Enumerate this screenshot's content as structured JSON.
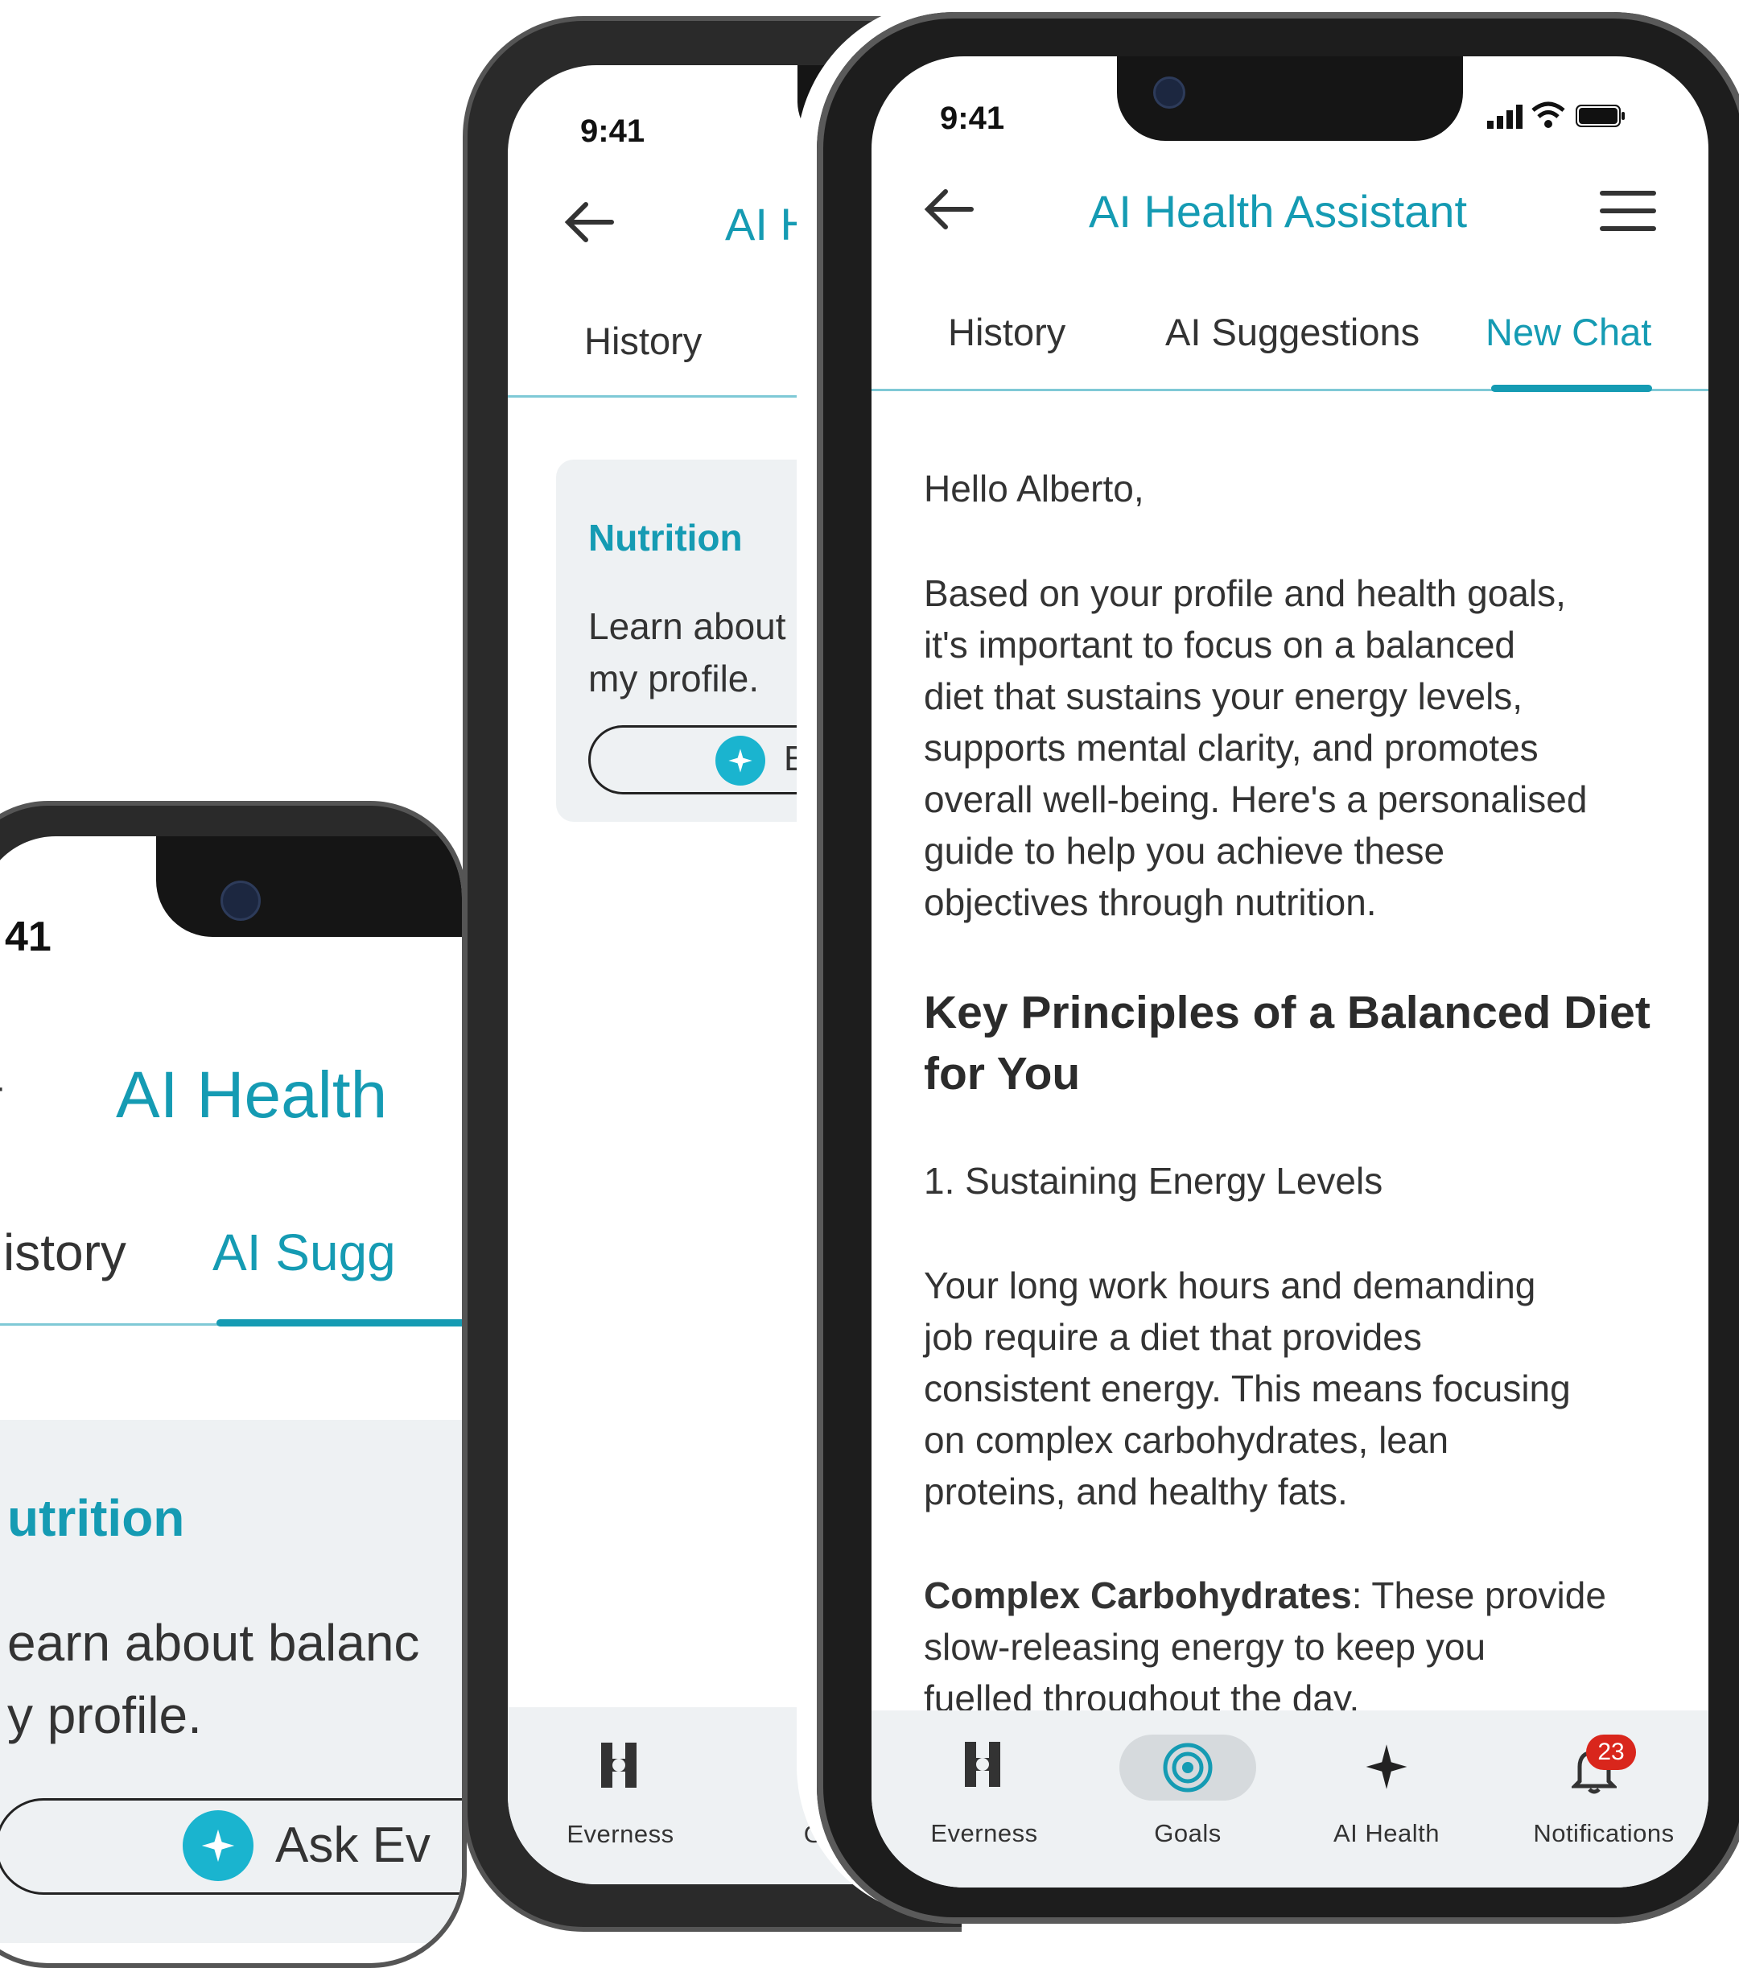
{
  "status": {
    "time": "9:41",
    "time_short": "41"
  },
  "header": {
    "title": "AI Health Assistant",
    "title_partial_small": "AI H",
    "title_partial_large": "AI Health"
  },
  "tabs": {
    "history": "History",
    "ai_suggestions": "AI Suggestions",
    "new_chat": "New Chat",
    "history_partial": "istory",
    "ai_sugg_partial": "AI Sugg",
    "ai_partial": "A"
  },
  "card": {
    "title": "Nutrition",
    "title_partial": "utrition",
    "line1": "Learn about",
    "line2": "my profile.",
    "line1_large": "earn about balanc",
    "line2_large": "y profile.",
    "button_partial_small": "E",
    "button_partial_large": "Ask Ev"
  },
  "chat": {
    "greeting": "Hello Alberto,",
    "intro": "Based on your profile and health goals,\nit's important to focus on a balanced\ndiet that sustains your energy levels,\nsupports mental clarity, and promotes\noverall well-being. Here's a personalised\nguide to help you achieve these\nobjectives through nutrition.",
    "heading": "Key Principles of a Balanced Diet\nfor You",
    "item1": "1. Sustaining Energy Levels",
    "para2": "Your long work hours and demanding\njob require a diet that provides\nconsistent energy. This means focusing\non complex carbohydrates, lean\nproteins, and healthy fats.",
    "bold_term": "Complex Carbohydrates",
    "bold_rest": ": These provide",
    "para3_rest": "slow-releasing energy to keep you\nfuelled throughout the day."
  },
  "nav": {
    "everness": "Everness",
    "goals": "Goals",
    "goals_partial": "G",
    "ai_health": "AI Health",
    "notifications": "Notifications",
    "badge": "23"
  },
  "colors": {
    "accent": "#159bb3",
    "badge": "#d9261c",
    "card_bg": "#eef1f3"
  }
}
